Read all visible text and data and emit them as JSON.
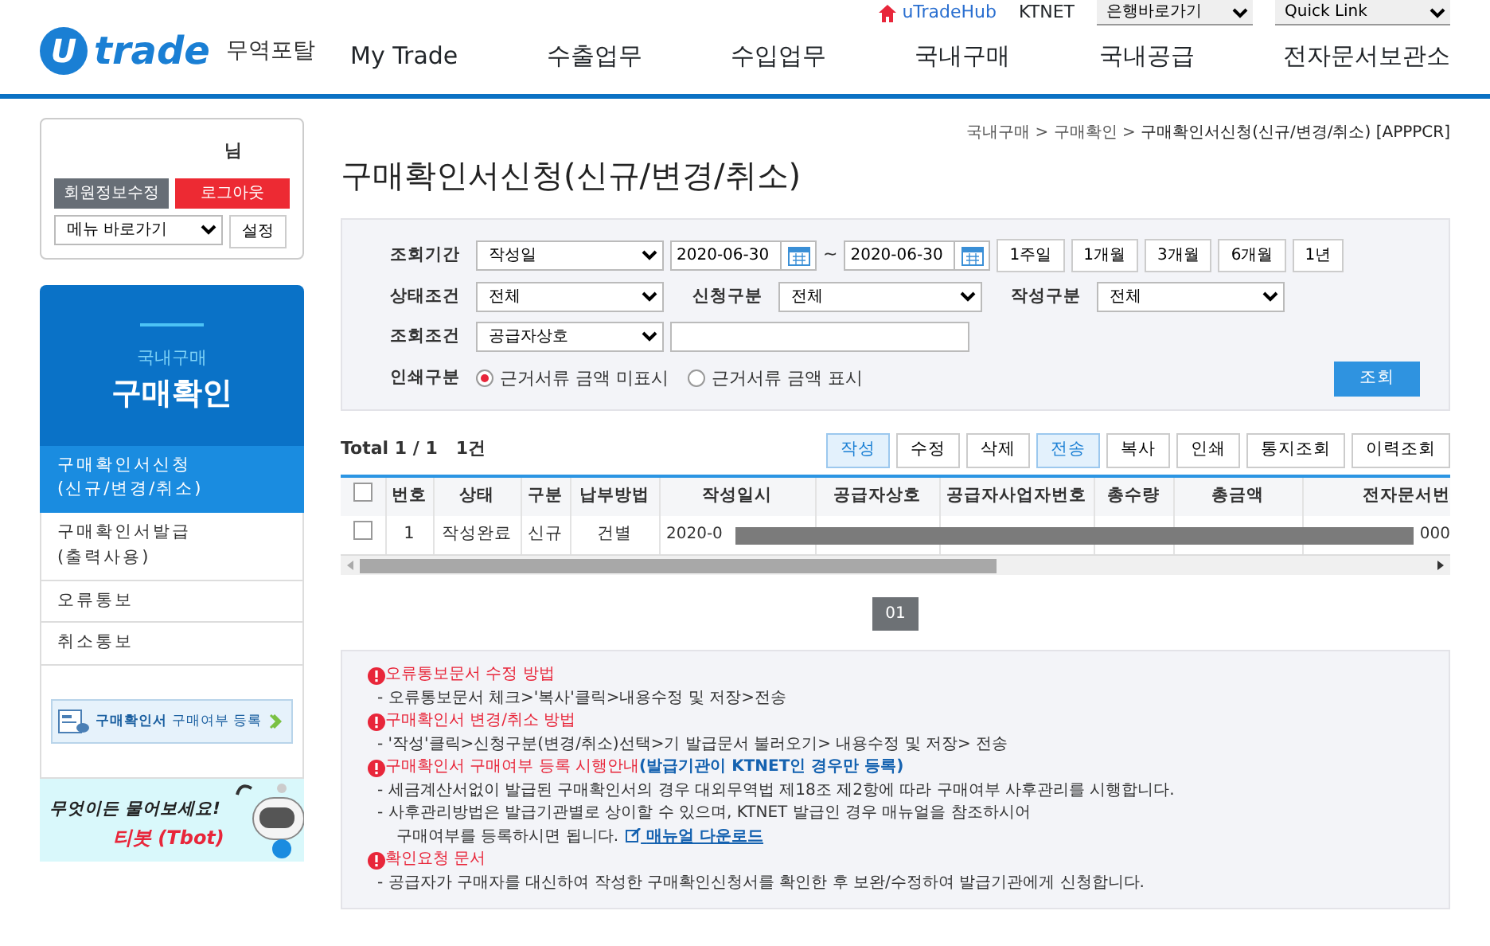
{
  "top_links": {
    "hub": "uTradeHub",
    "ktnet": "KTNET",
    "bank_select": "은행바로가기",
    "quick_select": "Quick Link"
  },
  "logo": {
    "mark": "U",
    "word": "trade",
    "portal": "무역포탈"
  },
  "nav": [
    {
      "label": "My Trade"
    },
    {
      "label": "수출업무"
    },
    {
      "label": "수입업무"
    },
    {
      "label": "국내구매"
    },
    {
      "label": "국내공급"
    },
    {
      "label": "전자문서보관소"
    }
  ],
  "user": {
    "suffix": "님",
    "edit": "회원정보수정",
    "logout": "로그아웃",
    "menu_select": "메뉴 바로가기",
    "set": "설정"
  },
  "sidebar": {
    "category": "국내구매",
    "title": "구매확인",
    "items": [
      {
        "lines": [
          "구매확인서신청",
          "(신규/변경/취소)"
        ],
        "selected": true
      },
      {
        "lines": [
          "구매확인서발급",
          "(출력사용)"
        ],
        "selected": false
      },
      {
        "lines": [
          "오류통보"
        ],
        "selected": false
      },
      {
        "lines": [
          "취소통보"
        ],
        "selected": false
      }
    ],
    "banner": {
      "strong": "구매확인서",
      "rest": "구매여부 등록"
    },
    "tbot": {
      "ask": "무엇이든 물어보세요!",
      "name": "티봇 (Tbot)"
    }
  },
  "breadcrumb": [
    "국내구매",
    "구매확인",
    "구매확인서신청(신규/변경/취소) [APPPCR]"
  ],
  "breadcrumb_separator": ">",
  "page_title": "구매확인서신청(신규/변경/취소)",
  "search": {
    "period_label": "조회기간",
    "period_type": "작성일",
    "date_from": "2020-06-30",
    "tilde": "~",
    "date_to": "2020-06-30",
    "quick": [
      "1주일",
      "1개월",
      "3개월",
      "6개월",
      "1년"
    ],
    "status_label": "상태조건",
    "status": "전체",
    "apply_label": "신청구분",
    "apply": "전체",
    "write_label": "작성구분",
    "write": "전체",
    "cond_label": "조회조건",
    "cond": "공급자상호",
    "print_label": "인쇄구분",
    "print_options": [
      {
        "label": "근거서류 금액 미표시",
        "selected": true
      },
      {
        "label": "근거서류 금액 표시",
        "selected": false
      }
    ],
    "submit": "조회"
  },
  "total": "Total 1 / 1   1건",
  "actions": [
    {
      "label": "작성",
      "highlighted": true
    },
    {
      "label": "수정",
      "highlighted": false
    },
    {
      "label": "삭제",
      "highlighted": false
    },
    {
      "label": "전송",
      "highlighted": true
    },
    {
      "label": "복사",
      "highlighted": false
    },
    {
      "label": "인쇄",
      "highlighted": false
    },
    {
      "label": "통지조회",
      "highlighted": false
    },
    {
      "label": "이력조회",
      "highlighted": false
    }
  ],
  "table": {
    "all_checked": false,
    "columns": [
      "번호",
      "상태",
      "구분",
      "납부방법",
      "작성일시",
      "공급자상호",
      "공급자사업자번호",
      "총수량",
      "총금액",
      "전자문서번"
    ],
    "rows": [
      {
        "checked": false,
        "cells": [
          "1",
          "작성완료",
          "신규",
          "건별",
          "2020-0",
          "",
          "",
          "",
          "",
          "000"
        ]
      }
    ]
  },
  "pages": [
    {
      "label": "01",
      "selected": true
    }
  ],
  "notes": [
    {
      "title": "오류통보문서 수정 방법",
      "lines": [
        [
          "- 오류통보문서 체크>'복사'클릭>내용수정 및 저장>전송"
        ]
      ]
    },
    {
      "title": "구매확인서 변경/취소 방법",
      "lines": [
        [
          "- '작성'클릭>신청구분(변경/취소)선택>기 발급문서 불러오기> 내용수정 및 저장> 전송"
        ]
      ]
    },
    {
      "title": "구매확인서 구매여부 등록 시행안내",
      "note": "(발급기관이 KTNET인 경우만 등록)",
      "lines": [
        [
          "- 세금계산서없이 발급된 구매확인서의 경우 대외무역법 제18조 제2항에 따라 구매여부 사후관리를 시행합니다."
        ],
        [
          "- 사후관리방법은 발급기관별로 상이할 수 있으며, KTNET 발급인 경우 매뉴얼을 참조하시어",
          "구매여부를 등록하시면 됩니다."
        ]
      ],
      "link": "매뉴얼 다운로드"
    },
    {
      "title": "확인요청 문서",
      "lines": [
        [
          "- 공급자가 구매자를 대신하여 작성한 구매확인신청서를 확인한 후 보완/수정하여 발급기관에게 신청합니다."
        ]
      ]
    }
  ]
}
